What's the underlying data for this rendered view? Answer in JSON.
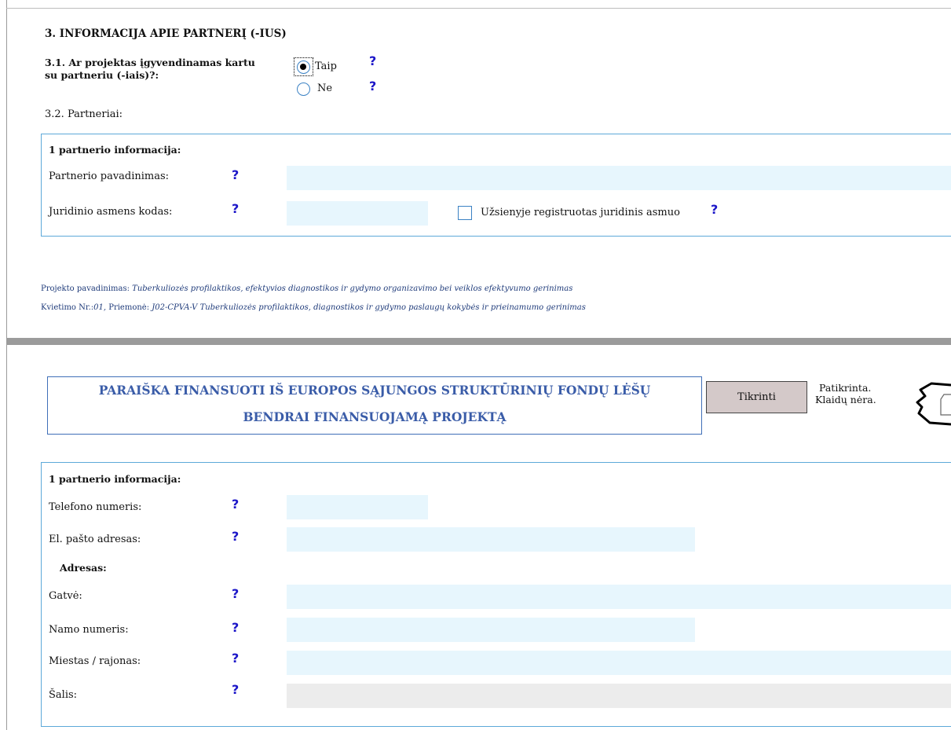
{
  "section3": {
    "title": "3. INFORMACIJA APIE PARTNERĮ (-IUS)",
    "q31_line1": "3.1. Ar projektas įgyvendinamas kartu",
    "q31_line2": "su partneriu (-iais)?:",
    "option_yes": "Taip",
    "option_no": "Ne",
    "selected": "Taip",
    "q32": "3.2. Partneriai:"
  },
  "help_glyph": "?",
  "partner_panel_1": {
    "heading": "1 partnerio informacija:",
    "name_label": "Partnerio pavadinimas:",
    "name_value": "",
    "code_label": "Juridinio asmens kodas:",
    "code_value": "",
    "foreign_label": "Užsienyje registruotas juridinis asmuo",
    "foreign_checked": false
  },
  "footer": {
    "project_label": "Projekto pavadinimas:",
    "project_value": "Tuberkuliozės profilaktikos, efektyvios diagnostikos ir gydymo organizavimo bei veiklos efektyvumo gerinimas",
    "call_label": "Kvietimo Nr.:",
    "call_value": "01,",
    "measure_label": "Priemonė:",
    "measure_value": "J02-CPVA-V Tuberkuliozės profilaktikos, diagnostikos ir gydymo paslaugų kokybės ir prieinamumo gerinimas"
  },
  "header": {
    "title_line1": "PARAIŠKA FINANSUOTI IŠ EUROPOS SĄJUNGOS STRUKTŪRINIŲ FONDŲ LĖŠŲ",
    "title_line2": "BENDRAI FINANSUOJAMĄ PROJEKTĄ",
    "check_button": "Tikrinti",
    "status_line1": "Patikrinta.",
    "status_line2": "Klaidų nėra."
  },
  "partner_panel_2": {
    "heading": "1 partnerio informacija:",
    "phone_label": "Telefono numeris:",
    "email_label": "El. pašto adresas:",
    "address_heading": "Adresas:",
    "street_label": "Gatvė:",
    "house_label": "Namo numeris:",
    "city_label": "Miestas / rajonas:",
    "country_label": "Šalis:"
  },
  "colors": {
    "help": "#1c16c8",
    "field": "#e7f6fd",
    "panel_border": "#5da9d9",
    "title": "#3a5ca8"
  }
}
